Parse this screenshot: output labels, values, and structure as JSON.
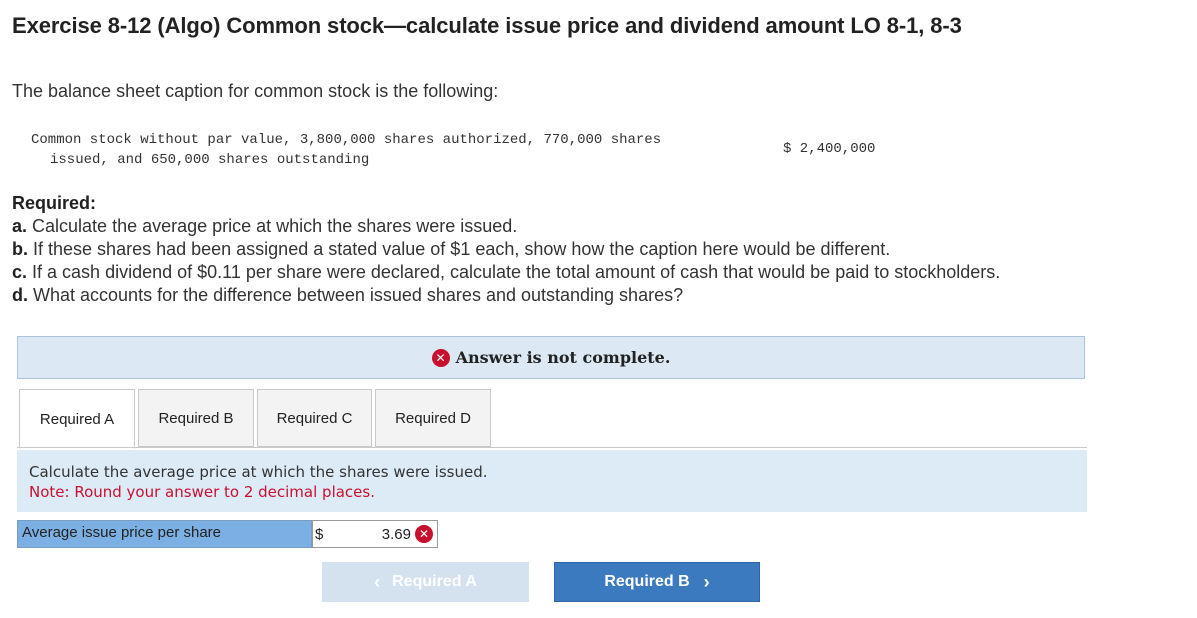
{
  "title": "Exercise 8-12 (Algo) Common stock—calculate issue price and dividend amount LO 8-1, 8-3",
  "intro": "The balance sheet caption for common stock is the following:",
  "caption": {
    "line1": "Common stock without par value, 3,800,000 shares authorized, 770,000 shares",
    "line2": "issued, and 650,000 shares outstanding",
    "amount": "$ 2,400,000"
  },
  "required": {
    "heading": "Required:",
    "items": [
      {
        "letter": "a.",
        "text": "Calculate the average price at which the shares were issued."
      },
      {
        "letter": "b.",
        "text": "If these shares had been assigned a stated value of $1 each, show how the caption here would be different."
      },
      {
        "letter": "c.",
        "text": "If a cash dividend of $0.11 per share were declared, calculate the total amount of cash that would be paid to stockholders."
      },
      {
        "letter": "d.",
        "text": "What accounts for the difference between issued shares and outstanding shares?"
      }
    ]
  },
  "banner": {
    "icon": "x-circle-icon",
    "text": "Answer is not complete."
  },
  "tabs": [
    {
      "label": "Required A",
      "active": true
    },
    {
      "label": "Required B",
      "active": false
    },
    {
      "label": "Required C",
      "active": false
    },
    {
      "label": "Required D",
      "active": false
    }
  ],
  "instructions": {
    "text": "Calculate the average price at which the shares were issued.",
    "note": "Note: Round your answer to 2 decimal places."
  },
  "answer": {
    "label": "Average issue price per share",
    "currency": "$",
    "value": "3.69",
    "status_icon": "x-circle-icon"
  },
  "nav": {
    "prev_label": "Required A",
    "next_label": "Required B"
  },
  "colors": {
    "error": "#c8102e",
    "banner_bg": "#dce9f5",
    "primary_button": "#3c7abf",
    "disabled_button": "#d4e1ef",
    "answer_label_bg": "#7cb0e4"
  }
}
